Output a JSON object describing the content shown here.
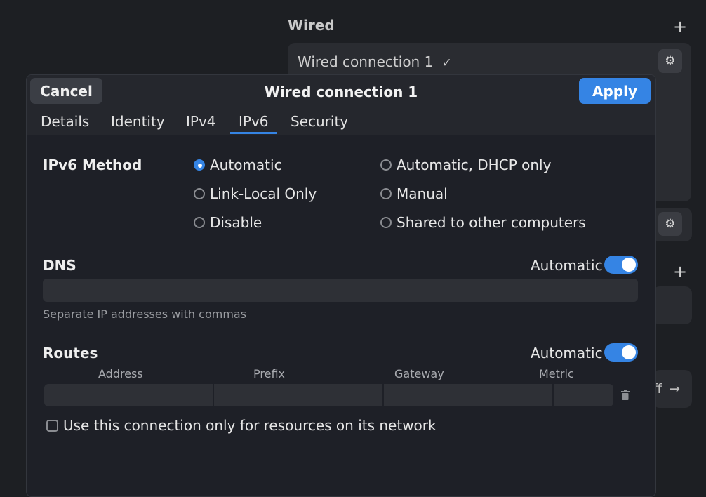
{
  "background": {
    "section_title": "Wired",
    "connection_label": "Wired connection 1",
    "check_mark": "✓",
    "partial_off_text": "ff",
    "arrow_glyph": "→",
    "plus_glyph": "+",
    "gear_glyph": "⚙"
  },
  "dialog": {
    "title": "Wired connection 1",
    "cancel_label": "Cancel",
    "apply_label": "Apply",
    "tabs": [
      {
        "label": "Details"
      },
      {
        "label": "Identity"
      },
      {
        "label": "IPv4"
      },
      {
        "label": "IPv6",
        "active": true
      },
      {
        "label": "Security"
      }
    ],
    "ipv6_method": {
      "label": "IPv6 Method",
      "options": [
        {
          "label": "Automatic",
          "selected": true
        },
        {
          "label": "Automatic, DHCP only",
          "selected": false
        },
        {
          "label": "Link-Local Only",
          "selected": false
        },
        {
          "label": "Manual",
          "selected": false
        },
        {
          "label": "Disable",
          "selected": false
        },
        {
          "label": "Shared to other computers",
          "selected": false
        }
      ]
    },
    "dns": {
      "label": "DNS",
      "automatic_label": "Automatic",
      "automatic_on": true,
      "value": "",
      "hint": "Separate IP addresses with commas"
    },
    "routes": {
      "label": "Routes",
      "automatic_label": "Automatic",
      "automatic_on": true,
      "columns": [
        "Address",
        "Prefix",
        "Gateway",
        "Metric"
      ]
    },
    "restrict_checkbox": {
      "label": "Use this connection only for resources on its network",
      "checked": false
    }
  },
  "colors": {
    "accent": "#3584e4",
    "dialog_bg": "#1e2027",
    "entry_bg": "#2e3036"
  }
}
